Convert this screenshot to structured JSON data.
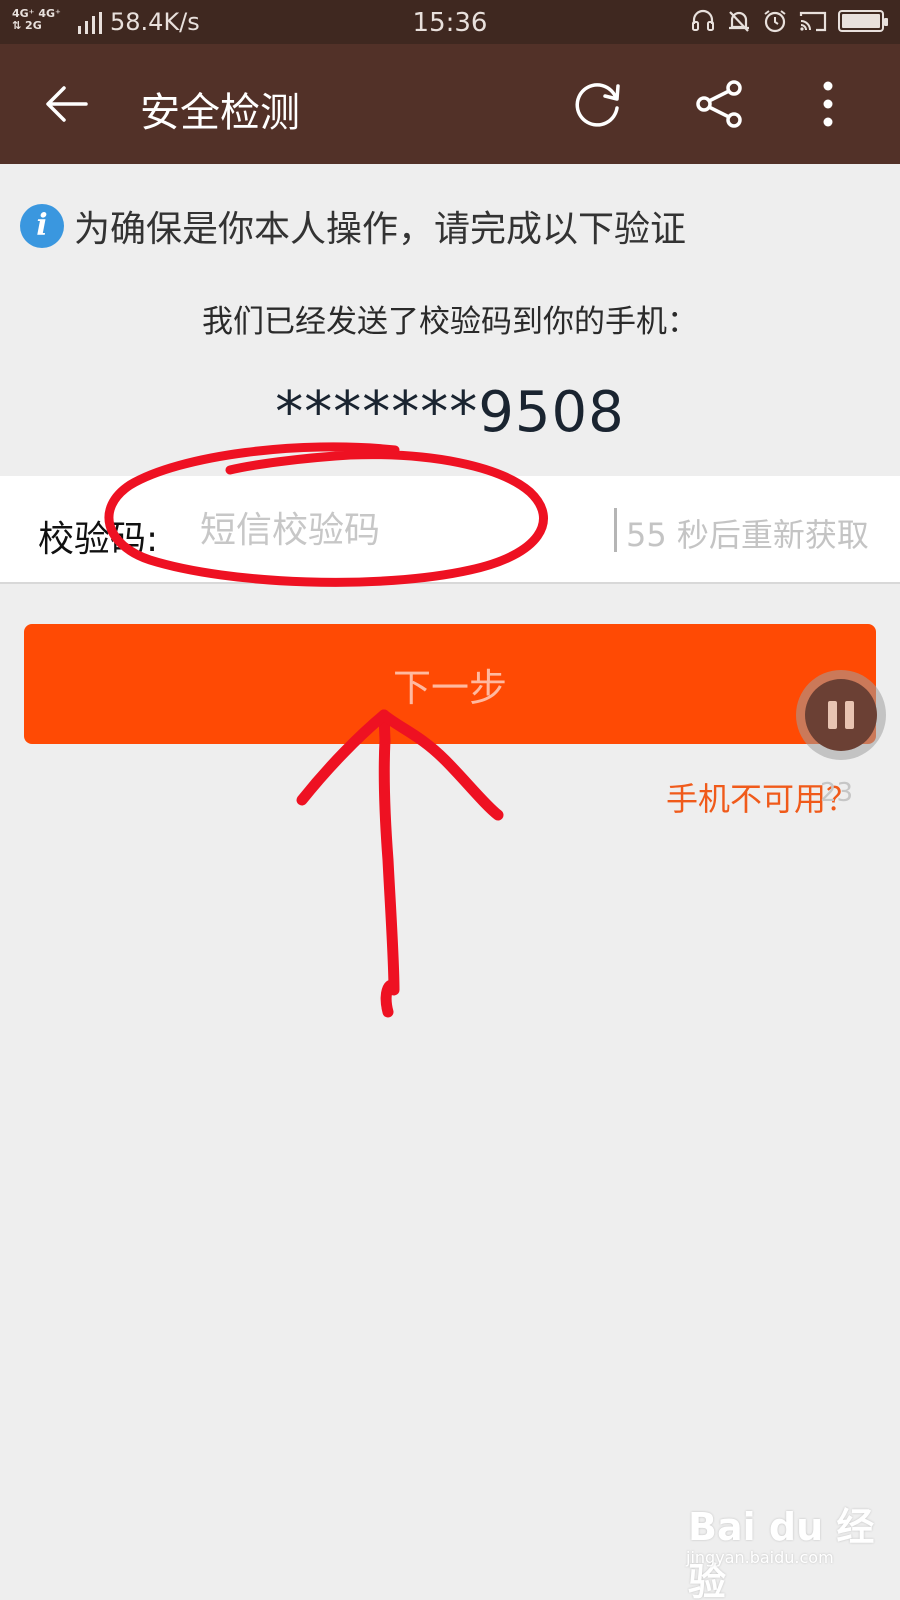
{
  "status_bar": {
    "network_top": "4G⁺ 4G⁺",
    "network_bottom": "⇅    2G",
    "speed": "58.4K/s",
    "time": "15:36",
    "icons": [
      "headset-icon",
      "bell-muted-icon",
      "alarm-icon",
      "cast-icon",
      "battery-icon"
    ]
  },
  "app_bar": {
    "title": "安全检测",
    "icons": [
      "back-arrow-icon",
      "refresh-icon",
      "share-icon",
      "more-vert-icon"
    ]
  },
  "notice": {
    "icon": "info-icon",
    "icon_glyph": "i",
    "text": "为确保是你本人操作，请完成以下验证"
  },
  "sent_message": "我们已经发送了校验码到你的手机：",
  "phone_number": "*******9508",
  "code_field": {
    "label": "校验码:",
    "placeholder": "短信校验码",
    "value": "",
    "resend": "55 秒后重新获取"
  },
  "next_button": "下一步",
  "phone_unavailable": "手机不可用？",
  "floating_recorder": {
    "icon": "pause-icon",
    "count": "23"
  },
  "annotation": {
    "color": "#ee1122",
    "marks": [
      "circle-around-input",
      "arrow-pointing-up"
    ]
  },
  "watermark": {
    "logo": "Bai du 经验",
    "url": "jingyan.baidu.com"
  },
  "colors": {
    "status_bar": "#3f2820",
    "app_bar": "#523128",
    "background": "#eeeeee",
    "primary_button": "#ff4a04",
    "link": "#f05a1a",
    "info": "#3a97df"
  }
}
